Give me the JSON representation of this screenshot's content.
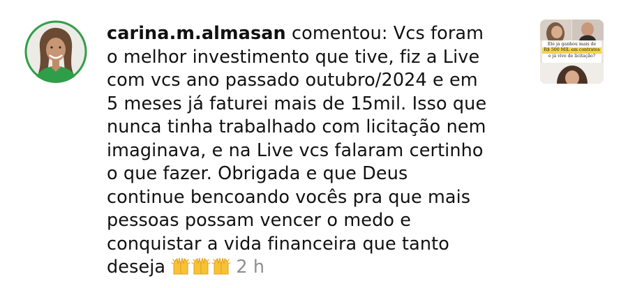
{
  "comment": {
    "username": "carina.m.almasan",
    "action": " comentou: Vcs foram",
    "lines": [
      "o melhor investimento que tive, fiz a Live",
      "com vcs ano passado outubro/2024 e em",
      "5 meses já faturei mais de 15mil. Isso que",
      "nunca tinha trabalhado com licitação nem",
      "imaginava, e na Live vcs falaram certinho",
      "o que fazer. Obrigada e que Deus",
      "continue bencoando vocês pra que mais",
      "pessoas possam vencer o medo e",
      "conquistar a vida financeira que tanto"
    ],
    "last_word": "deseja",
    "emoji_count": 3,
    "emoji_icon": "raising-hands-icon",
    "timestamp": "2 h"
  },
  "thumbnail": {
    "caption_line1": "Ele já ganhou mais de",
    "caption_highlight": "R$ 500 MIL em contratos",
    "caption_line3": "e já vive de licitação?"
  },
  "colors": {
    "timestamp": "#8e8e8e",
    "avatar_ring": "#2f9e49",
    "caption_highlight": "#f2d64b"
  }
}
